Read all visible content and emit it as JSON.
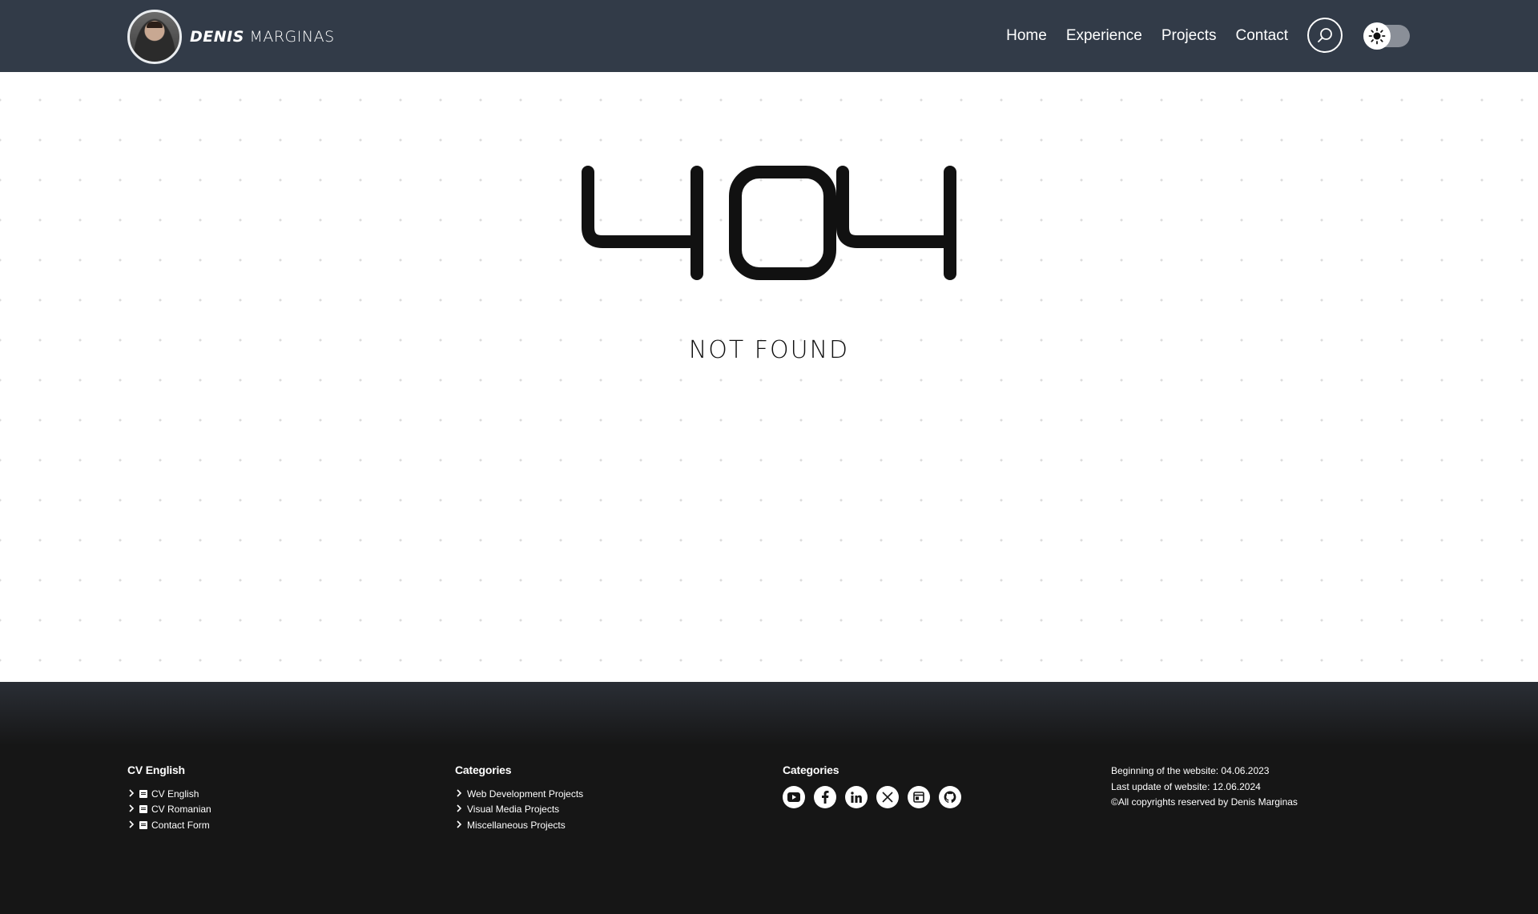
{
  "header": {
    "brand": {
      "first": "Denis",
      "last": "Marginas"
    },
    "nav": [
      "Home",
      "Experience",
      "Projects",
      "Contact"
    ],
    "search_icon": "search-icon",
    "theme_toggle": {
      "state": "light",
      "icon": "sun-icon"
    }
  },
  "error": {
    "code": "404",
    "message": "Not Found"
  },
  "footer": {
    "cv": {
      "title": "CV English",
      "links": [
        "CV English",
        "CV Romanian",
        "Contact Form"
      ]
    },
    "categories": {
      "title": "Categories",
      "links": [
        "Web Development Projects",
        "Visual Media Projects",
        "Miscellaneous Projects"
      ]
    },
    "social": {
      "title": "Categories",
      "icons": [
        "youtube-icon",
        "facebook-icon",
        "linkedin-icon",
        "x-icon",
        "website-icon",
        "github-icon"
      ]
    },
    "info": {
      "lines": [
        "Beginning of the website: 04.06.2023",
        "Last update of website: 12.06.2024",
        "©All copyrights reserved by Denis Marginas"
      ]
    }
  },
  "colors": {
    "header_bg": "#323b48",
    "footer_bg": "#161616",
    "text_dark": "#111111"
  }
}
